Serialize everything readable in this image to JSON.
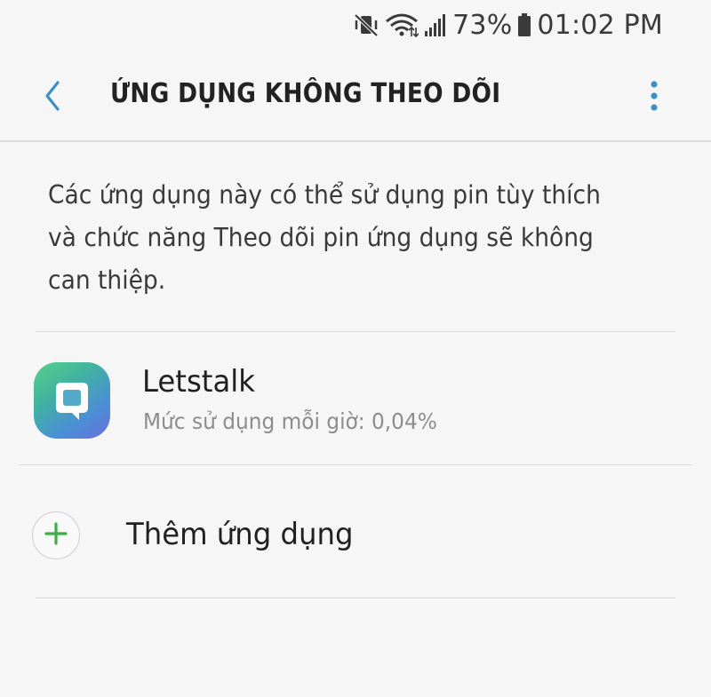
{
  "status_bar": {
    "battery_percent": "73%",
    "time": "01:02 PM",
    "icons": [
      "vibrate-icon",
      "wifi-icon",
      "signal-icon",
      "battery-icon"
    ]
  },
  "header": {
    "title": "ỨNG DỤNG KHÔNG THEO DÕI",
    "back_icon": "chevron-left-icon",
    "more_icon": "more-vertical-icon"
  },
  "description": "Các ứng dụng này có thể sử dụng pin tùy thích và chức năng Theo dõi pin ứng dụng sẽ không can thiệp.",
  "apps": [
    {
      "name": "Letstalk",
      "usage": "Mức sử dụng mỗi giờ: 0,04%",
      "icon": "letstalk-app-icon"
    }
  ],
  "add_app": {
    "label": "Thêm ứng dụng",
    "icon": "plus-icon"
  },
  "colors": {
    "accent": "#3f8fc4",
    "add_green": "#3cb043",
    "background": "#f6f6f6",
    "secondary_text": "#8d8d8d"
  }
}
